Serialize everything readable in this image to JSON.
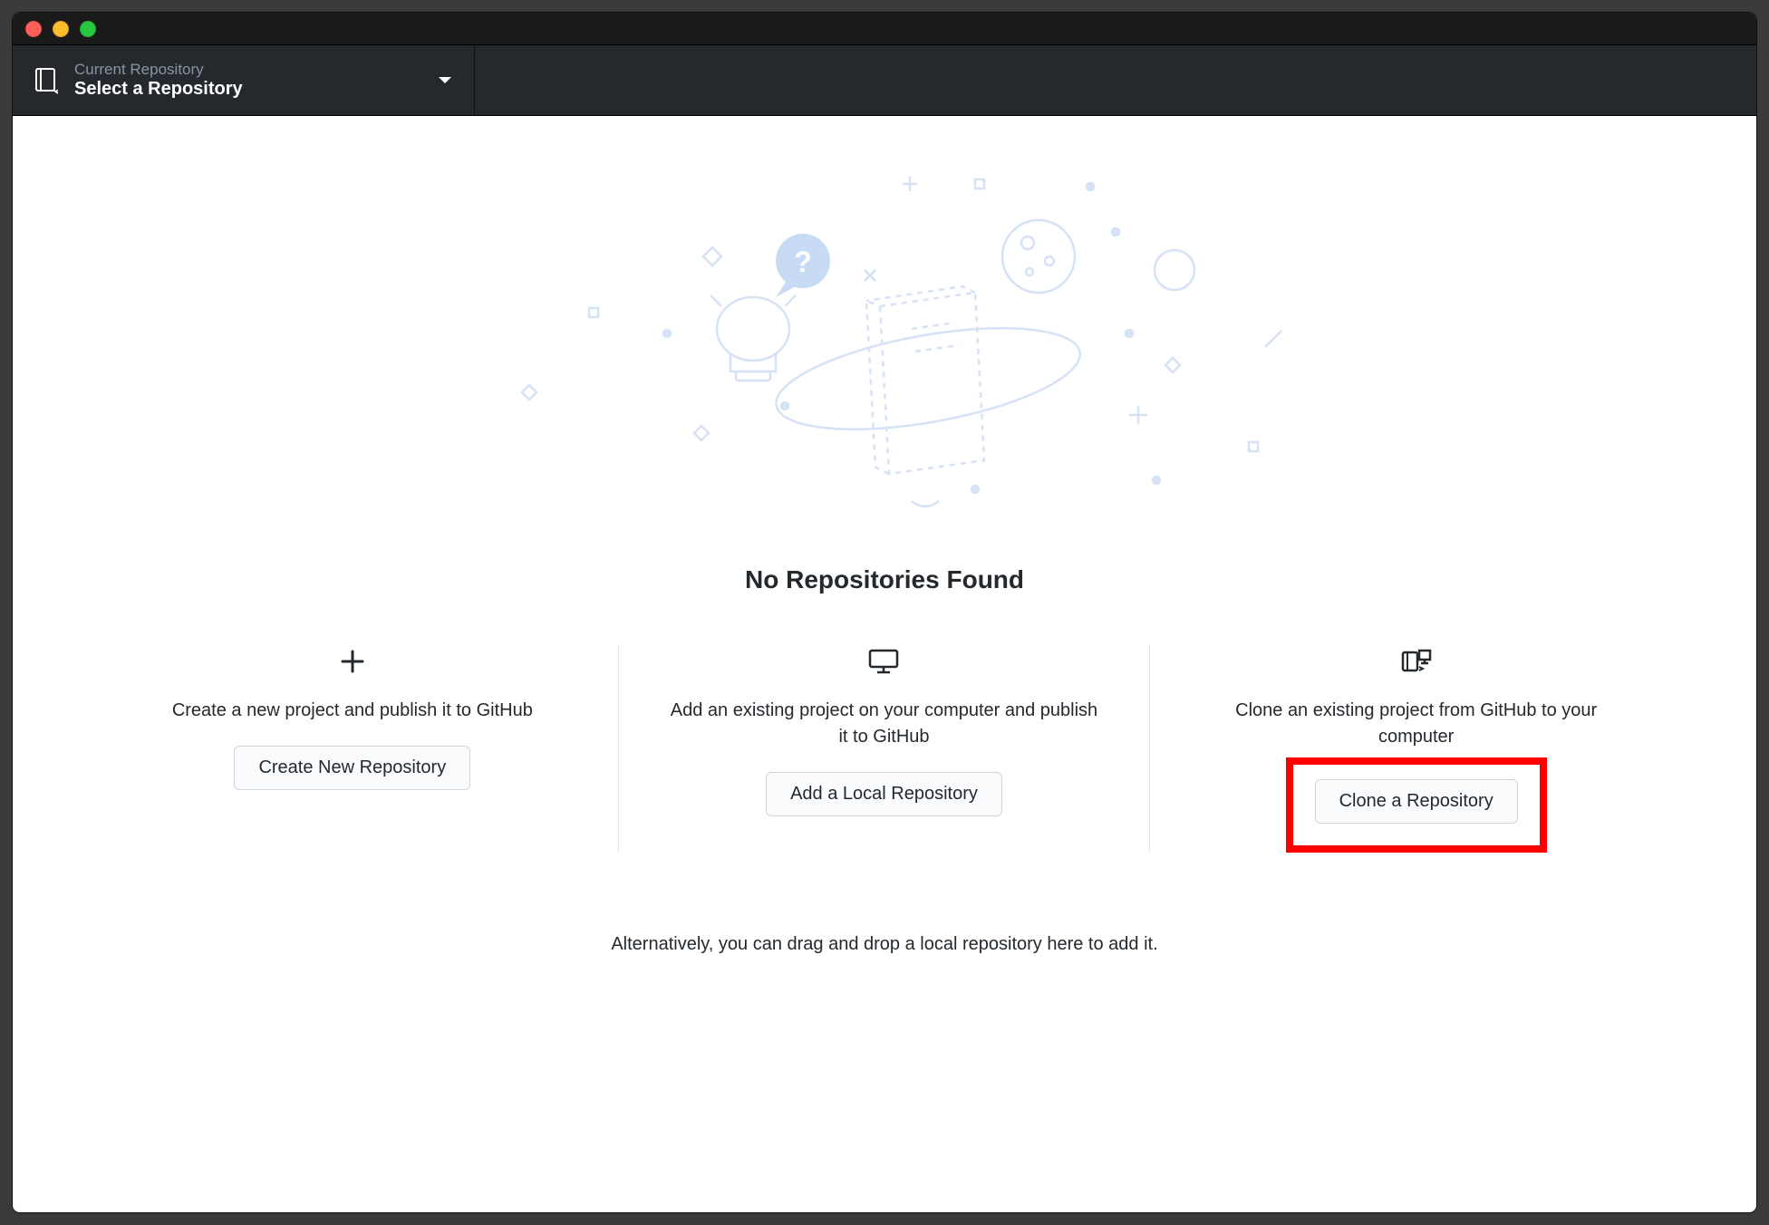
{
  "toolbar": {
    "repo_label": "Current Repository",
    "repo_value": "Select a Repository"
  },
  "main": {
    "heading": "No Repositories Found",
    "alt_text": "Alternatively, you can drag and drop a local repository here to add it."
  },
  "options": [
    {
      "desc": "Create a new project and publish it to GitHub",
      "button": "Create New Repository"
    },
    {
      "desc": "Add an existing project on your computer and publish it to GitHub",
      "button": "Add a Local Repository"
    },
    {
      "desc": "Clone an existing project from GitHub to your computer",
      "button": "Clone a Repository"
    }
  ]
}
